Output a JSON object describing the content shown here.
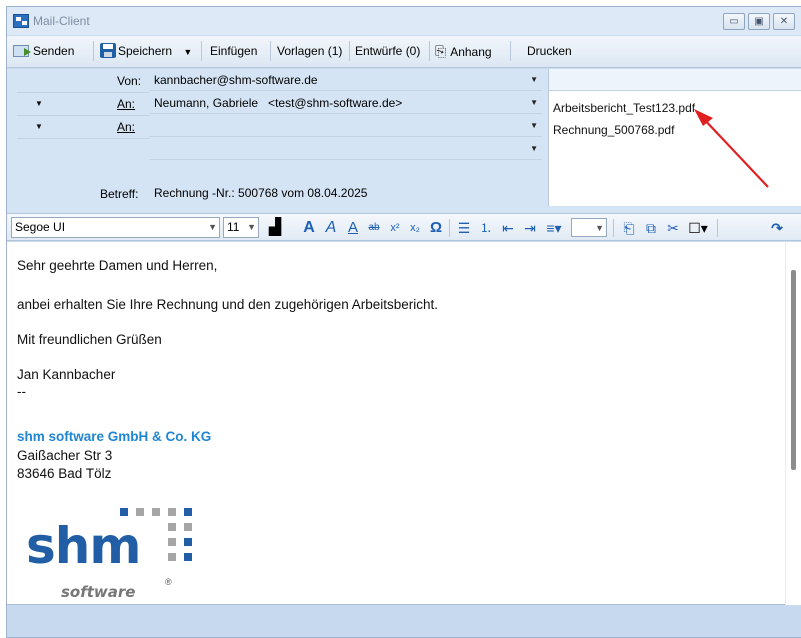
{
  "window": {
    "title": "Mail-Client"
  },
  "toolbar": {
    "send": "Senden",
    "save": "Speichern",
    "insert": "Einfügen",
    "templates": "Vorlagen (1)",
    "drafts": "Entwürfe (0)",
    "attachment": "Anhang",
    "print": "Drucken"
  },
  "header": {
    "from_label": "Von:",
    "from_value": "kannbacher@shm-software.de",
    "to_label": "An:",
    "to_value": "Neumann, Gabriele   <test@shm-software.de>",
    "to2_label": "An:",
    "to2_value": "",
    "extra_value": "",
    "subject_label": "Betreff:",
    "subject_value": "Rechnung -Nr.: 500768 vom 08.04.2025"
  },
  "attachments": [
    "Arbeitsbericht_Test123.pdf",
    "Rechnung_500768.pdf"
  ],
  "format": {
    "font": "Segoe UI",
    "size": "11"
  },
  "body": {
    "greeting": "Sehr geehrte Damen und Herren,",
    "text": "anbei erhalten Sie Ihre Rechnung und den zugehörigen Arbeitsbericht.",
    "closing": "Mit freundlichen Grüßen",
    "sender": "Jan Kannbacher",
    "sig_sep": "--",
    "company": "shm software GmbH & Co. KG",
    "street": "Gaißacher Str 3",
    "city": "83646 Bad Tölz"
  },
  "logo": {
    "word": "shm",
    "sub": "software",
    "reg": "®"
  },
  "colors": {
    "arrow": "#e02020",
    "company": "#1e86d2",
    "logo_blue": "#215ea5"
  }
}
